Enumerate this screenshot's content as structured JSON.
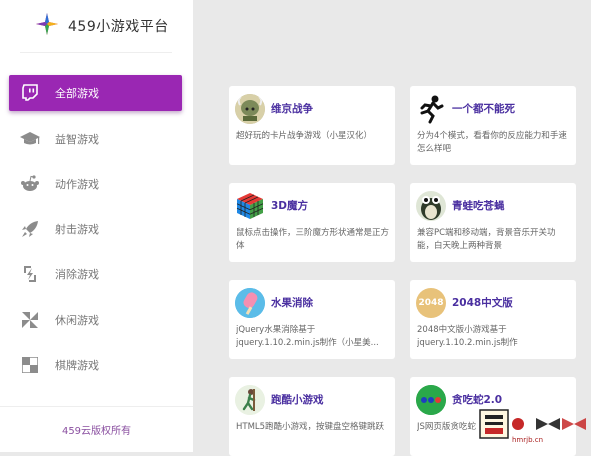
{
  "app": {
    "title": "459小游戏平台"
  },
  "sidebar": {
    "items": [
      {
        "label": "全部游戏",
        "icon": "twitch-icon",
        "active": true
      },
      {
        "label": "益智游戏",
        "icon": "graduation-cap-icon",
        "active": false
      },
      {
        "label": "动作游戏",
        "icon": "reddit-icon",
        "active": false
      },
      {
        "label": "射击游戏",
        "icon": "rocket-icon",
        "active": false
      },
      {
        "label": "消除游戏",
        "icon": "lightning-box-icon",
        "active": false
      },
      {
        "label": "休闲游戏",
        "icon": "pinwheel-icon",
        "active": false
      },
      {
        "label": "棋牌游戏",
        "icon": "checker-icon",
        "active": false
      }
    ],
    "footer": "459云版权所有"
  },
  "games": [
    {
      "title": "维京战争",
      "desc": "超好玩的卡片战争游戏（小星汉化）",
      "icon": "viking-icon"
    },
    {
      "title": "一个都不能死",
      "desc": "分为4个模式，看看你的反应能力和手速怎么样吧",
      "icon": "running-man-icon"
    },
    {
      "title": "3D魔方",
      "desc": "鼠标点击操作，三阶魔方形状通常是正方体",
      "icon": "rubiks-cube-icon"
    },
    {
      "title": "青蛙吃苍蝇",
      "desc": "兼容PC端和移动端，背景音乐开关功能，白天晚上两种背景",
      "icon": "frog-icon"
    },
    {
      "title": "水果消除",
      "desc": "jQuery水果消除基于jquery.1.10.2.min.js制作（小星美...",
      "icon": "popsicle-icon"
    },
    {
      "title": "2048中文版",
      "desc": "2048中文版小游戏基于jquery.1.10.2.min.js制作",
      "icon": "2048-icon",
      "icon_text": "2048"
    },
    {
      "title": "跑酷小游戏",
      "desc": "HTML5跑酷小游戏，按键盘空格键跳跃",
      "icon": "parkour-icon"
    },
    {
      "title": "贪吃蛇2.0",
      "desc": "JS网页版贪吃蛇",
      "icon": "snake-icon"
    }
  ],
  "watermark": {
    "text": "hmrjb.cn"
  },
  "colors": {
    "accent": "#9a27b3",
    "title": "#4a2fa0",
    "background": "#e9e9e9"
  }
}
